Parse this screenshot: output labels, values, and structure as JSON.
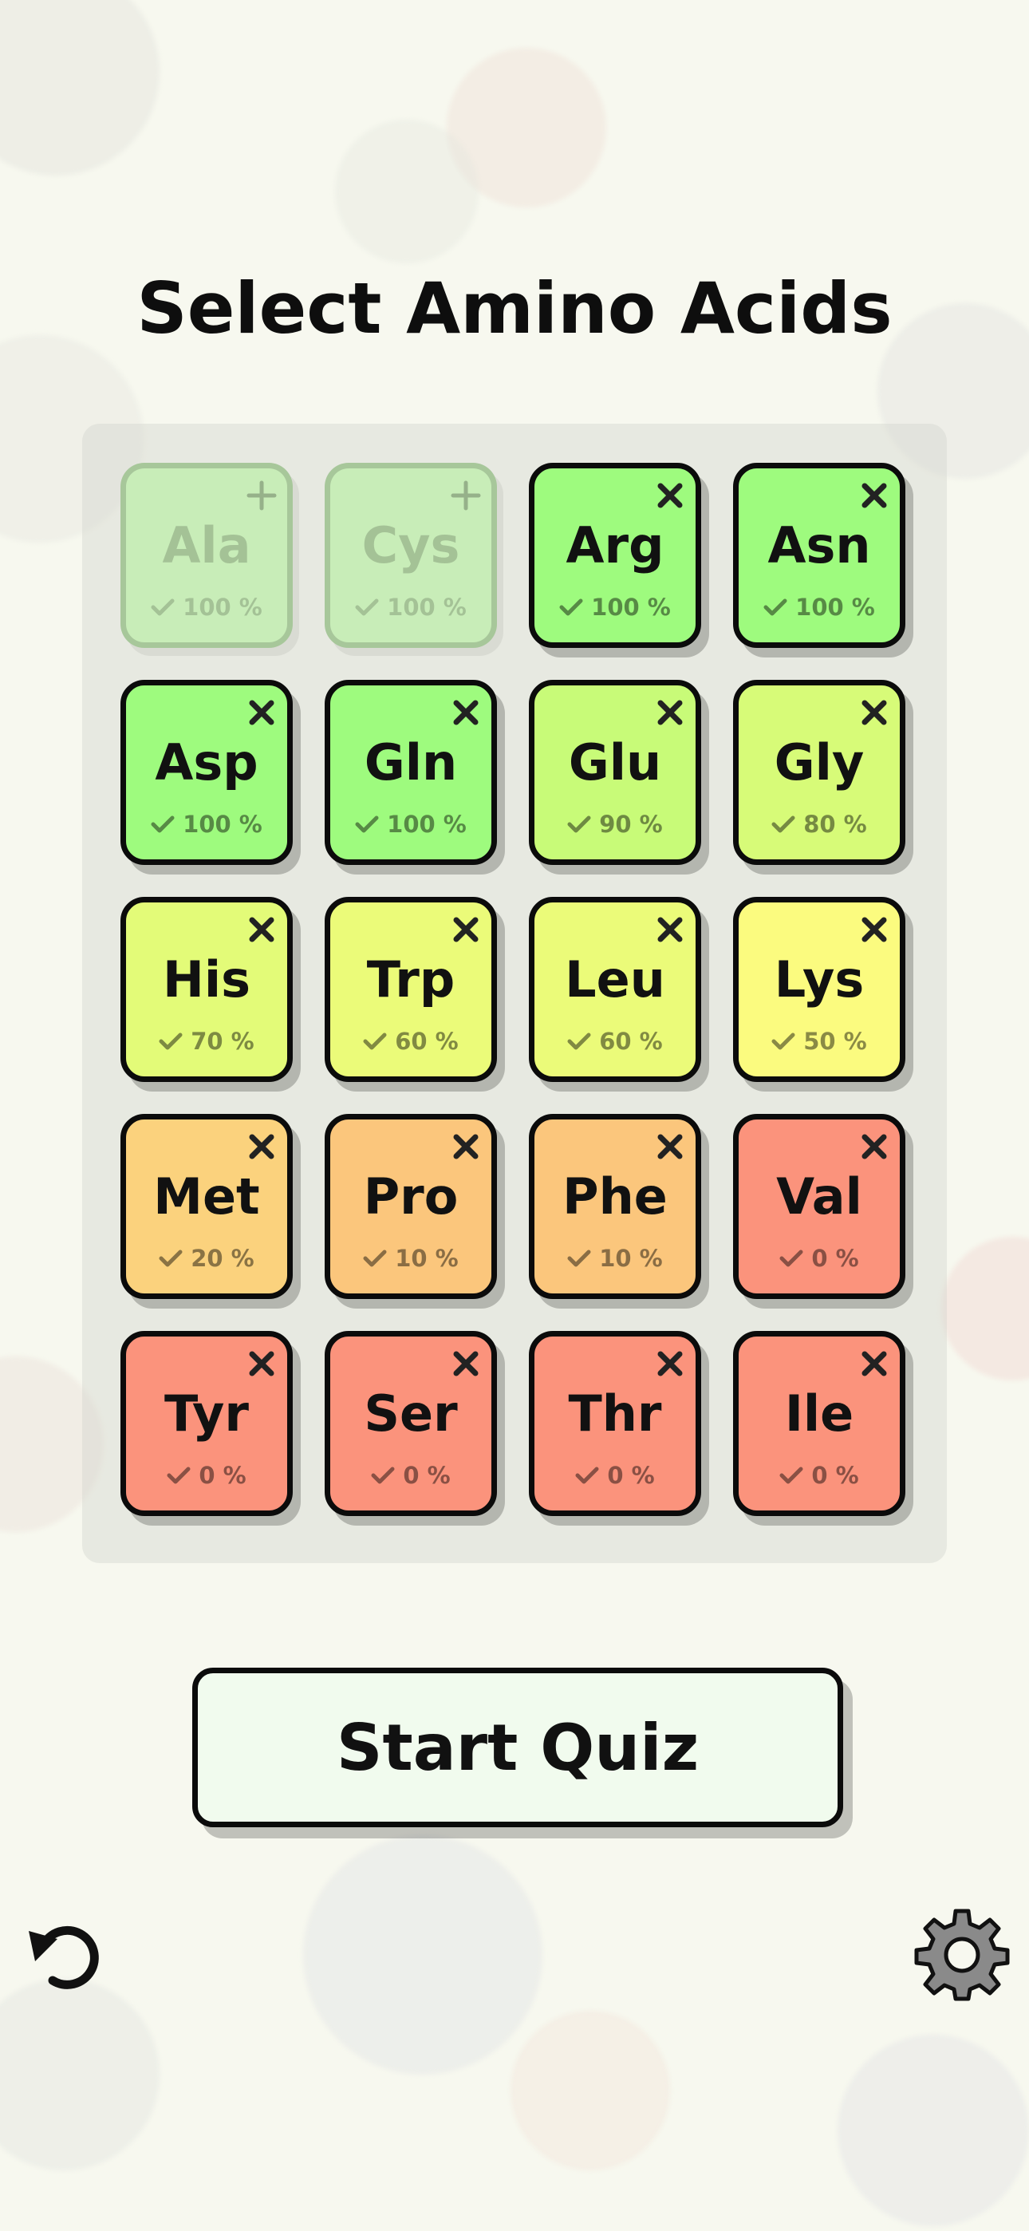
{
  "header": {
    "title": "Select Amino Acids"
  },
  "tiles": [
    {
      "abbr": "Ala",
      "percent": "100 %",
      "selected": false,
      "color": "#c8edb8"
    },
    {
      "abbr": "Cys",
      "percent": "100 %",
      "selected": false,
      "color": "#c8edb8"
    },
    {
      "abbr": "Arg",
      "percent": "100 %",
      "selected": true,
      "color": "#9efb7e"
    },
    {
      "abbr": "Asn",
      "percent": "100 %",
      "selected": true,
      "color": "#9efb7e"
    },
    {
      "abbr": "Asp",
      "percent": "100 %",
      "selected": true,
      "color": "#9efb7e"
    },
    {
      "abbr": "Gln",
      "percent": "100 %",
      "selected": true,
      "color": "#9efb7e"
    },
    {
      "abbr": "Glu",
      "percent": "90 %",
      "selected": true,
      "color": "#c8fb78"
    },
    {
      "abbr": "Gly",
      "percent": "80 %",
      "selected": true,
      "color": "#d7fb78"
    },
    {
      "abbr": "His",
      "percent": "70 %",
      "selected": true,
      "color": "#e3fb78"
    },
    {
      "abbr": "Trp",
      "percent": "60 %",
      "selected": true,
      "color": "#ebfb79"
    },
    {
      "abbr": "Leu",
      "percent": "60 %",
      "selected": true,
      "color": "#ebfb79"
    },
    {
      "abbr": "Lys",
      "percent": "50 %",
      "selected": true,
      "color": "#fbfb7f"
    },
    {
      "abbr": "Met",
      "percent": "20 %",
      "selected": true,
      "color": "#fbd27d"
    },
    {
      "abbr": "Pro",
      "percent": "10 %",
      "selected": true,
      "color": "#fbc67c"
    },
    {
      "abbr": "Phe",
      "percent": "10 %",
      "selected": true,
      "color": "#fbc67c"
    },
    {
      "abbr": "Val",
      "percent": "0 %",
      "selected": true,
      "color": "#fb937c"
    },
    {
      "abbr": "Tyr",
      "percent": "0 %",
      "selected": true,
      "color": "#fb937c"
    },
    {
      "abbr": "Ser",
      "percent": "0 %",
      "selected": true,
      "color": "#fb937c"
    },
    {
      "abbr": "Thr",
      "percent": "0 %",
      "selected": true,
      "color": "#fb937c"
    },
    {
      "abbr": "Ile",
      "percent": "0 %",
      "selected": true,
      "color": "#fb937c"
    }
  ],
  "actions": {
    "start_label": "Start Quiz"
  },
  "icons": {
    "reset": "undo-icon",
    "settings": "gear-icon",
    "remove": "close-icon",
    "add": "plus-icon",
    "progress": "check-icon"
  }
}
